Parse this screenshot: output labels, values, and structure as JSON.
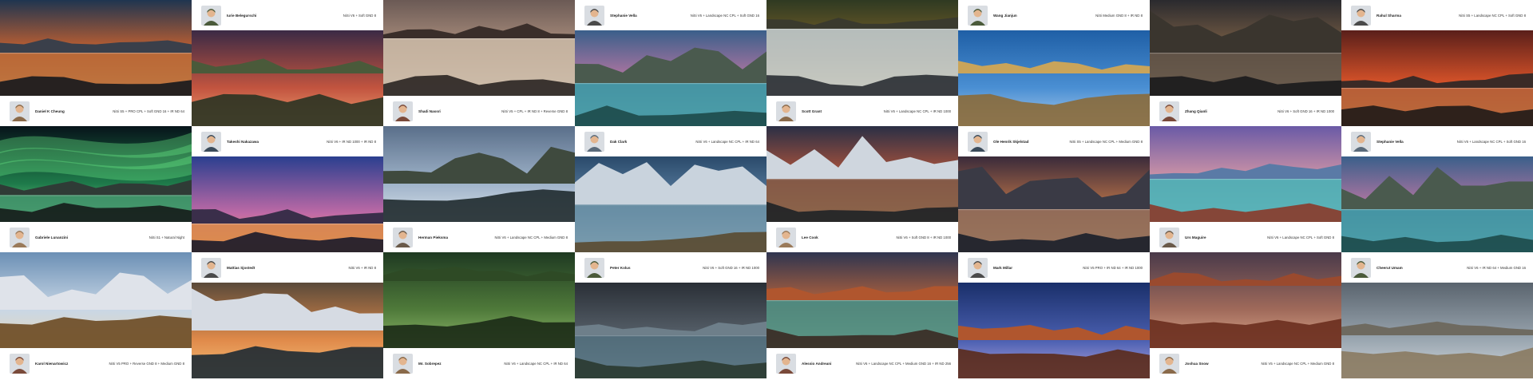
{
  "gallery": {
    "columns": [
      {
        "col": 1,
        "cells": [
          {
            "kind": "photo",
            "scene": "coastal-sunset-rocks"
          },
          {
            "kind": "credit",
            "name": "Daniel K Cheung",
            "gear": "NiSi S5 + PRO CPL + Soft GND 16 + IR ND 64"
          },
          {
            "kind": "photo",
            "scene": "aurora-borealis-lake"
          },
          {
            "kind": "credit",
            "name": "Gabriele Lunanzini",
            "gear": "NiSi S1 + Natural Night"
          },
          {
            "kind": "photo",
            "scene": "snowy-peaks-autumn-trees"
          },
          {
            "kind": "credit",
            "name": "Karol Nienartowicz",
            "gear": "NiSi V5 PRO + Reverse GND 8 + Medium GND 8"
          }
        ]
      },
      {
        "col": 2,
        "cells": [
          {
            "kind": "credit",
            "name": "Iurie Belegurschi",
            "gear": "NiSi V6 + Soft GND 8"
          },
          {
            "kind": "photo",
            "scene": "canyon-waterfall-sunset"
          },
          {
            "kind": "credit",
            "name": "Takeshi Nakazawa",
            "gear": "NiSi V6 + IR ND 1000 + IR ND 8"
          },
          {
            "kind": "photo",
            "scene": "purple-dusk-mountain-lake"
          },
          {
            "kind": "credit",
            "name": "Mattias Sjostedt",
            "gear": "NiSi V6 + IR ND 8"
          },
          {
            "kind": "photo",
            "scene": "fjord-glacier-sunset"
          }
        ]
      },
      {
        "col": 3,
        "cells": [
          {
            "kind": "photo",
            "scene": "sea-stacks-long-exposure"
          },
          {
            "kind": "credit",
            "name": "Shadi Nassri",
            "gear": "NiSi V5 + CPL + IR ND 8 + Reverse GND 8"
          },
          {
            "kind": "photo",
            "scene": "red-cabins-harbor"
          },
          {
            "kind": "credit",
            "name": "Herman Pieksma",
            "gear": "NiSi V6 + Landscape NC CPL + Medium GND 8"
          },
          {
            "kind": "photo",
            "scene": "forest-waterfall-mossy"
          },
          {
            "kind": "credit",
            "name": "Mr. Sobrepez",
            "gear": "NiSi V6 + Landscape NC CPL + IR ND 64"
          }
        ]
      },
      {
        "col": 4,
        "cells": [
          {
            "kind": "credit",
            "name": "Stephanie Vella",
            "gear": "NiSi V6 + Landscape NC CPL + Soft GND 16"
          },
          {
            "kind": "photo",
            "scene": "alpine-lake-boathouse"
          },
          {
            "kind": "credit",
            "name": "Dak Clark",
            "gear": "NiSi V6 + Landscape NC CPL + IR ND 64"
          },
          {
            "kind": "photo",
            "scene": "patagonia-peaks-river"
          },
          {
            "kind": "credit",
            "name": "Peter Kolus",
            "gear": "NiSi V6 + Soft GND 16 + IR ND 1000"
          },
          {
            "kind": "photo",
            "scene": "lighthouse-stormy-sea"
          }
        ]
      },
      {
        "col": 5,
        "cells": [
          {
            "kind": "photo",
            "scene": "autumn-bridge-stream"
          },
          {
            "kind": "credit",
            "name": "Scott Grant",
            "gear": "NiSi V6 + Landscape NC CPL + IR ND 1000"
          },
          {
            "kind": "photo",
            "scene": "fitzroy-sunrise-lake"
          },
          {
            "kind": "credit",
            "name": "Lee Cook",
            "gear": "NiSi V6 + Soft GND 8 + IR ND 1000"
          },
          {
            "kind": "photo",
            "scene": "coastal-cliffs-sunset"
          },
          {
            "kind": "credit",
            "name": "Alessio Andreani",
            "gear": "NiSi V6 + Landscape NC CPL + Medium GND 16 + IR ND 256"
          }
        ]
      },
      {
        "col": 6,
        "cells": [
          {
            "kind": "credit",
            "name": "Wang Jianjun",
            "gear": "NiSi Medium GND 8 + IR ND 8"
          },
          {
            "kind": "photo",
            "scene": "badlands-blue-sky"
          },
          {
            "kind": "credit",
            "name": "Ole Henrik Skjelstad",
            "gear": "NiSi S5 + Landscape NC CPL + Medium GND 8"
          },
          {
            "kind": "photo",
            "scene": "mountain-reflection-dusk"
          },
          {
            "kind": "credit",
            "name": "Mark Millar",
            "gear": "NiSi V5 PRO + IR ND 64 + IR ND 1000"
          },
          {
            "kind": "photo",
            "scene": "arch-dead-tree-night"
          }
        ]
      },
      {
        "col": 7,
        "cells": [
          {
            "kind": "photo",
            "scene": "vestrahorn-reflection"
          },
          {
            "kind": "credit",
            "name": "Zhang Qianli",
            "gear": "NiSi V6 + Soft GND 16 + IR ND 1000"
          },
          {
            "kind": "photo",
            "scene": "red-tree-turquoise-lake"
          },
          {
            "kind": "credit",
            "name": "Urs Maguire",
            "gear": "NiSi V6 + Landscape NC CPL + Soft GND 8"
          },
          {
            "kind": "photo",
            "scene": "red-rock-valley"
          },
          {
            "kind": "credit",
            "name": "Joshua Snow",
            "gear": "NiSi V5 + Landscape NC CPL + Medium GND 8"
          }
        ]
      },
      {
        "col": 8,
        "cells": [
          {
            "kind": "credit",
            "name": "Rahul Sharma",
            "gear": "NiSi S5 + Landscape NC CPL + Soft GND 8"
          },
          {
            "kind": "photo",
            "scene": "fiery-sky-rocky-shore"
          },
          {
            "kind": "credit",
            "name": "Stephanie Vella",
            "gear": "NiSi V6 + Landscape NC CPL + Soft GND 16"
          },
          {
            "kind": "photo",
            "scene": "alpine-lake-boathouse"
          },
          {
            "kind": "credit",
            "name": "Cheerut Umam",
            "gear": "NiSi V6 + IR ND 64 + Medium GND 16"
          },
          {
            "kind": "photo",
            "scene": "desert-road-clouds"
          }
        ]
      }
    ]
  }
}
